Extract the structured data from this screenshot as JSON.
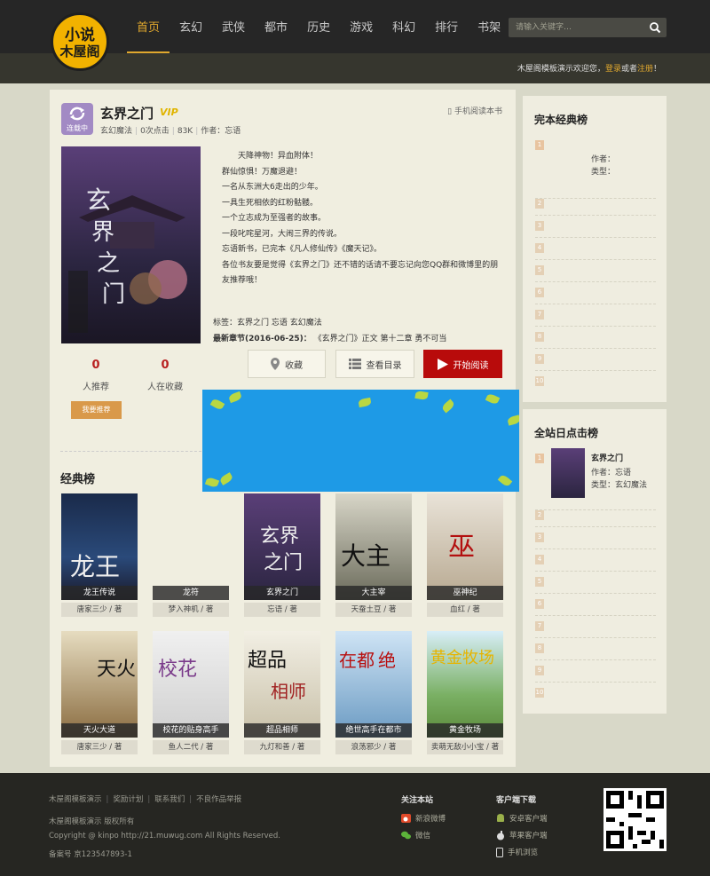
{
  "logo": {
    "line1": "小说",
    "line2": "木屋阁"
  },
  "nav": [
    "首页",
    "玄幻",
    "武侠",
    "都市",
    "历史",
    "游戏",
    "科幻",
    "排行",
    "书架"
  ],
  "search": {
    "placeholder": "请输入关键字…"
  },
  "welcome": {
    "text": "木屋阁模板演示欢迎您，",
    "login": "登录",
    "or": "或者",
    "register": "注册",
    "end": "！"
  },
  "book": {
    "status": "连载中",
    "title": "玄界之门",
    "vip": "VIP",
    "category": "玄幻魔法",
    "clicks": "0次点击",
    "size": "83K",
    "author_label": "作者：",
    "author": "忘语",
    "mobile": "手机阅读本书",
    "desc": [
      "天降神物！异血附体！",
      "群仙惊惧！万魔退避！",
      "一名从东洲大6走出的少年。",
      "一具生死相依的红粉骷髅。",
      "一个立志成为至强者的故事。",
      "一段叱咤星河，大闹三界的传说。",
      "忘语新书，已完本《凡人修仙传》《魔天记》。",
      "各位书友要是觉得《玄界之门》还不错的话请不要忘记向您QQ群和微博里的朋友推荐哦！"
    ],
    "tags": "标签：玄界之门 忘语 玄幻魔法",
    "latest_label": "最新章节(2016-06-25)：",
    "latest": "《玄界之门》正文 第十二章 勇不可当",
    "btn_fav": "收藏",
    "btn_toc": "查看目录",
    "btn_read": "开始阅读",
    "recommend_count": "0",
    "recommend_label": "人推荐",
    "collect_count": "0",
    "collect_label": "人在收藏",
    "recommend_btn": "我要推荐"
  },
  "classic": {
    "title": "经典榜",
    "books": [
      {
        "name": "龙王传说",
        "author": "唐家三少 / 著"
      },
      {
        "name": "龙符",
        "author": "梦入神机 / 著"
      },
      {
        "name": "玄界之门",
        "author": "忘语 / 著"
      },
      {
        "name": "大主宰",
        "author": "天蚕土豆 / 著"
      },
      {
        "name": "巫神纪",
        "author": "血红 / 著"
      },
      {
        "name": "天火大道",
        "author": "唐家三少 / 著"
      },
      {
        "name": "校花的贴身高手",
        "author": "鱼人二代 / 著"
      },
      {
        "name": "超品相师",
        "author": "九灯和善 / 著"
      },
      {
        "name": "绝世高手在都市",
        "author": "浪荡邪少 / 著"
      },
      {
        "name": "黄金牧场",
        "author": "卖萌无敌小小宝 / 著"
      }
    ]
  },
  "side1": {
    "title": "完本经典榜",
    "top_author_label": "作者：",
    "top_type_label": "类型：",
    "ranks": [
      "1",
      "2",
      "3",
      "4",
      "5",
      "6",
      "7",
      "8",
      "9",
      "10"
    ]
  },
  "side2": {
    "title": "全站日点击榜",
    "top_name": "玄界之门",
    "top_author": "作者：忘语",
    "top_type": "类型：玄幻魔法",
    "ranks": [
      "1",
      "2",
      "3",
      "4",
      "5",
      "6",
      "7",
      "8",
      "9",
      "10"
    ]
  },
  "footer": {
    "links": [
      "木屋阁模板演示",
      "奖励计划",
      "联系我们",
      "不良作品举报"
    ],
    "copy1": "木屋阁模板演示 版权所有",
    "copy2": "Copyright @ kinpo http://21.muwug.com All Rights Reserved.",
    "copy3": "备案号 京123547893-1",
    "follow_title": "关注本站",
    "weibo": "新浪微博",
    "wechat": "微信",
    "client_title": "客户端下载",
    "android": "安卓客户端",
    "ios": "苹果客户端",
    "mobile": "手机浏览"
  },
  "colors": {
    "accent": "#e0a82e",
    "read_button": "#b80b0b",
    "header": "#262626"
  }
}
